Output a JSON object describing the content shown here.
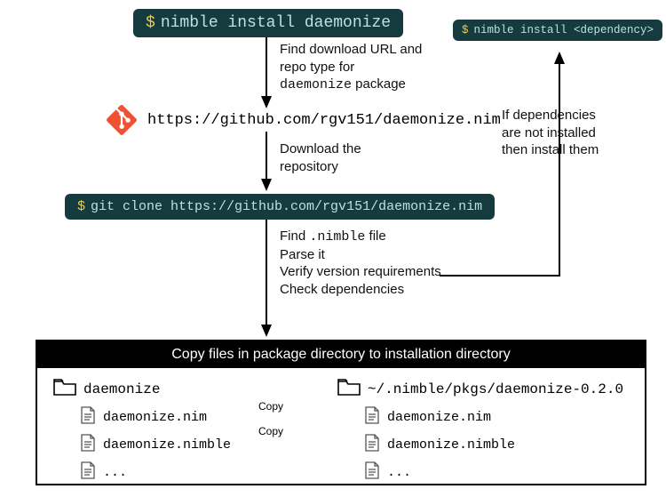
{
  "cmd1": {
    "prompt": "$",
    "text": "nimble install daemonize"
  },
  "step1": {
    "l1": "Find download URL and",
    "l2": "repo type for",
    "pkg": "daemonize",
    "l3": " package"
  },
  "repo_url": "https://github.com/rgv151/daemonize.nim",
  "step2": {
    "l1": "Download the",
    "l2": "repository"
  },
  "cmd2": {
    "prompt": "$",
    "text": "git clone https://github.com/rgv151/daemonize.nim"
  },
  "step3": {
    "l1a": "Find ",
    "l1b": ".nimble",
    "l1c": " file",
    "l2": "Parse it",
    "l3": "Verify version requirements",
    "l4": "Check dependencies"
  },
  "copybox": {
    "title": "Copy files in package directory to installation directory"
  },
  "folders": {
    "src": "daemonize",
    "dst": "~/.nimble/pkgs/daemonize-0.2.0"
  },
  "files": {
    "f1": "daemonize.nim",
    "f2": "daemonize.nimble",
    "f3": "..."
  },
  "copy_label": "Copy",
  "dep_note": {
    "l1": "If dependencies",
    "l2": "are not installed",
    "l3": "then install them"
  },
  "cmd3": {
    "prompt": "$",
    "text": "nimble install <dependency>"
  }
}
